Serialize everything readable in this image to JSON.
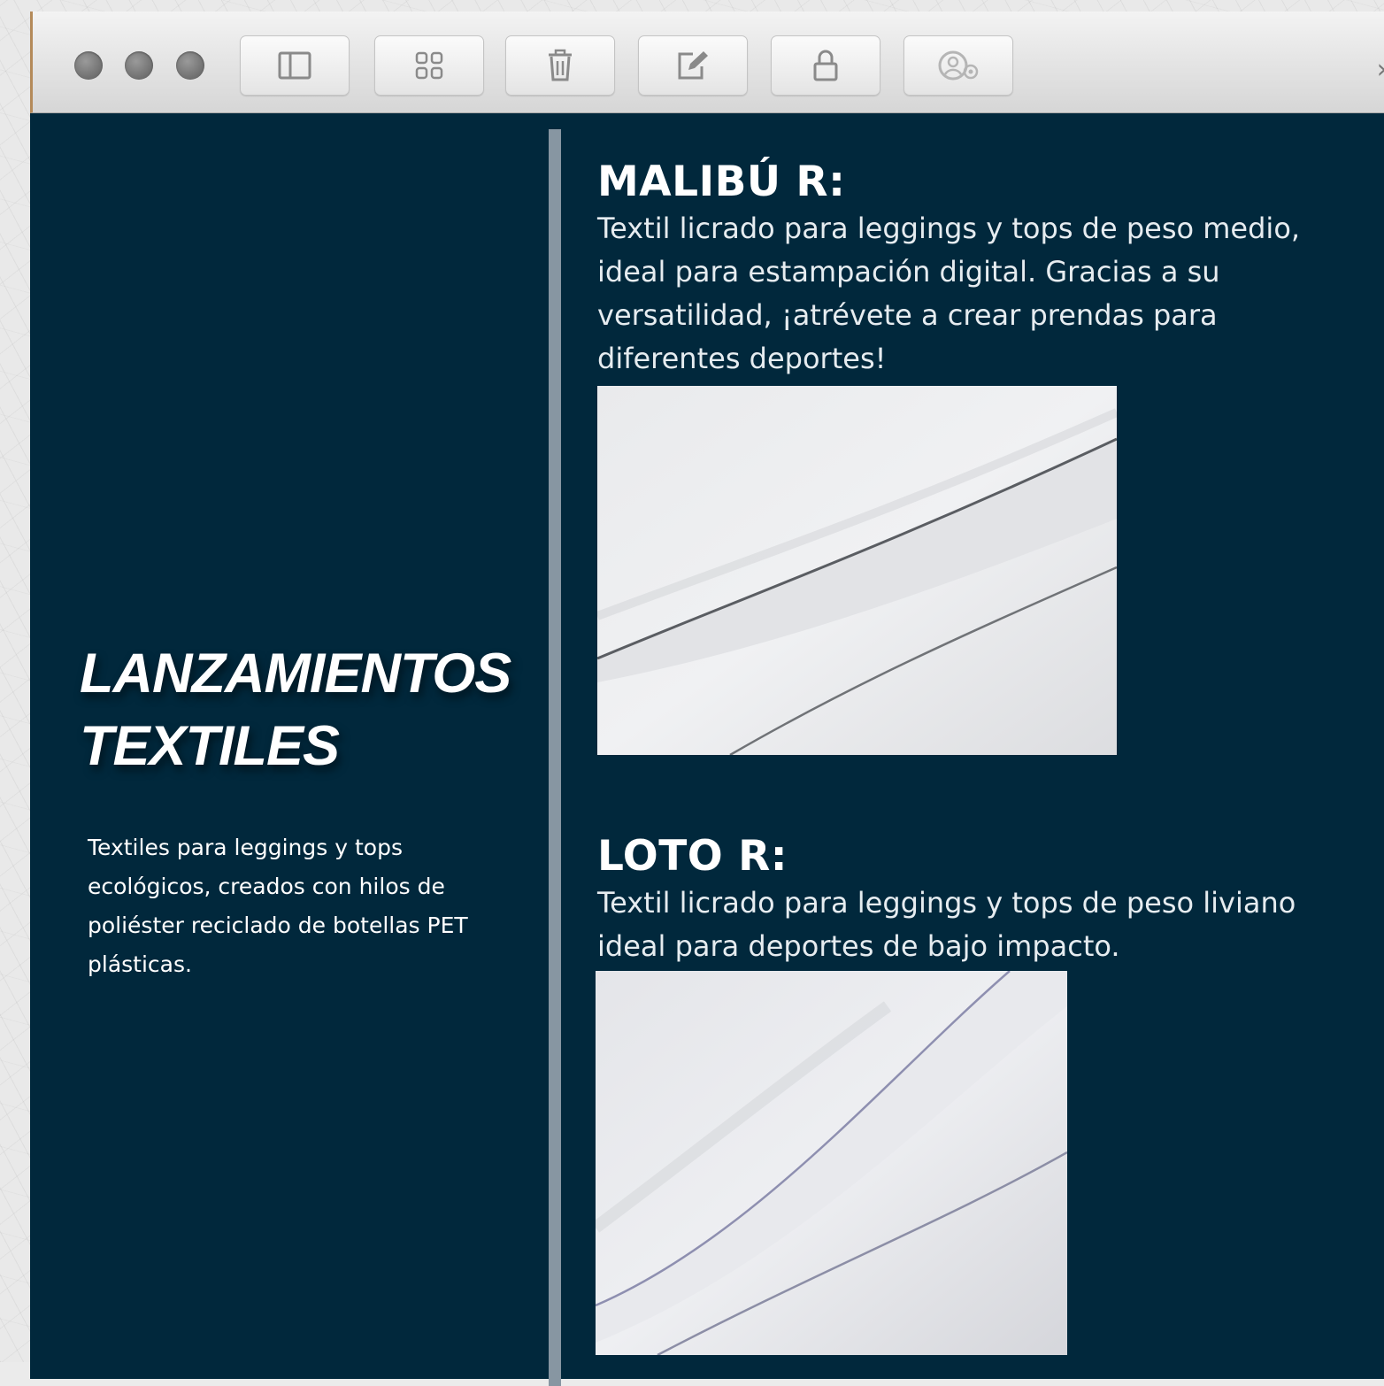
{
  "toolbar": {
    "window_controls": [
      {
        "name": "close-window-button"
      },
      {
        "name": "minimize-window-button"
      },
      {
        "name": "zoom-window-button"
      }
    ],
    "buttons": [
      {
        "name": "sidebar-toggle-button",
        "icon": "sidebar-icon"
      },
      {
        "name": "grid-view-button",
        "icon": "grid-icon"
      },
      {
        "name": "delete-button",
        "icon": "trash-icon"
      },
      {
        "name": "compose-button",
        "icon": "compose-icon"
      },
      {
        "name": "lock-button",
        "icon": "lock-icon"
      },
      {
        "name": "share-button",
        "icon": "user-share-icon"
      }
    ],
    "overflow_label": "»"
  },
  "sidebar": {
    "title": "LANZAMIENTOS TEXTILES",
    "description": "Textiles para leggings y tops ecológicos, creados con hilos de poliéster reciclado de botellas PET plásticas."
  },
  "products": [
    {
      "name": "MALIBÚ R:",
      "description": "Textil licrado para leggings y tops de peso medio, ideal para estampación digital. Gracias a su versatilidad, ¡atrévete a crear prendas para diferentes deportes!",
      "image": "white-fabric-photo"
    },
    {
      "name": "LOTO R:",
      "description": "Textil licrado para leggings y tops de peso liviano ideal para deportes de bajo impacto.",
      "image": "white-fabric-photo"
    }
  ],
  "colors": {
    "content_background": "#01283c",
    "divider": "#8796a2",
    "text": "#ffffff"
  }
}
